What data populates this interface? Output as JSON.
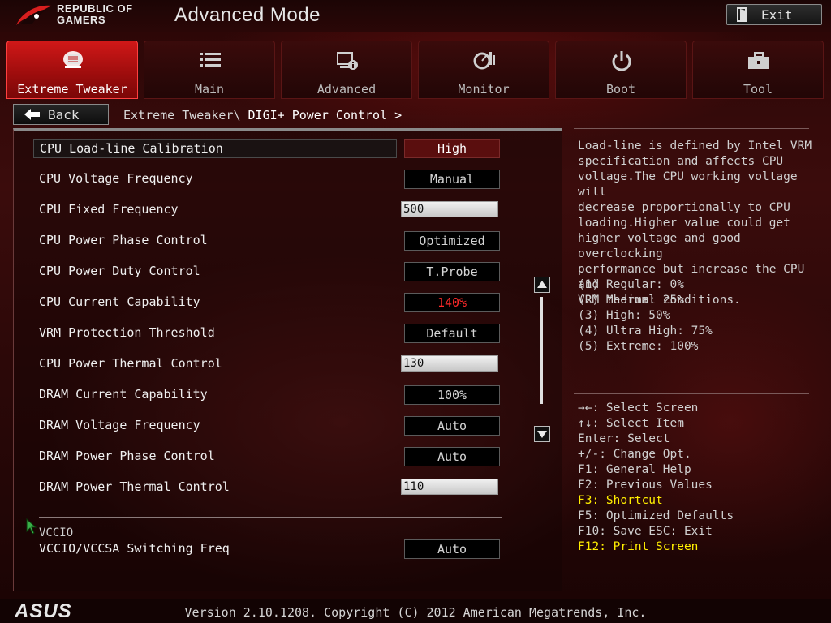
{
  "header": {
    "brand_line1": "REPUBLIC OF",
    "brand_line2": "GAMERS",
    "title": "Advanced Mode",
    "exit_label": "Exit"
  },
  "tabs": [
    {
      "label": "Extreme Tweaker",
      "icon": "extreme-tweaker-icon",
      "active": true
    },
    {
      "label": "Main",
      "icon": "list-icon",
      "active": false
    },
    {
      "label": "Advanced",
      "icon": "advanced-settings-icon",
      "active": false
    },
    {
      "label": "Monitor",
      "icon": "monitor-gauge-icon",
      "active": false
    },
    {
      "label": "Boot",
      "icon": "power-icon",
      "active": false
    },
    {
      "label": "Tool",
      "icon": "toolbox-icon",
      "active": false
    }
  ],
  "nav": {
    "back_label": "Back",
    "breadcrumb_parent": "Extreme Tweaker\\",
    "breadcrumb_current": "DIGI+ Power Control >"
  },
  "settings": [
    {
      "label": "CPU Load-line Calibration",
      "value": "High",
      "kind": "select",
      "selected": true
    },
    {
      "label": "CPU Voltage Frequency",
      "value": "Manual",
      "kind": "select"
    },
    {
      "label": "CPU Fixed Frequency",
      "value": "500",
      "kind": "input"
    },
    {
      "label": "CPU Power Phase Control",
      "value": "Optimized",
      "kind": "select"
    },
    {
      "label": "CPU Power Duty Control",
      "value": "T.Probe",
      "kind": "select"
    },
    {
      "label": "CPU Current Capability",
      "value": "140%",
      "kind": "select",
      "highlight": "#ff2a2a"
    },
    {
      "label": "VRM Protection Threshold",
      "value": "Default",
      "kind": "select"
    },
    {
      "label": "CPU Power Thermal Control",
      "value": "130",
      "kind": "input"
    },
    {
      "label": "DRAM Current Capability",
      "value": "100%",
      "kind": "select"
    },
    {
      "label": "DRAM Voltage Frequency",
      "value": "Auto",
      "kind": "select"
    },
    {
      "label": "DRAM Power Phase Control",
      "value": "Auto",
      "kind": "select"
    },
    {
      "label": "DRAM Power Thermal Control",
      "value": "110",
      "kind": "input"
    }
  ],
  "section": {
    "title": "VCCIO",
    "label": "VCCIO/VCCSA Switching Freq",
    "value": "Auto"
  },
  "help": {
    "description": [
      "Load-line is defined by Intel VRM",
      "specification and affects CPU",
      "voltage.The CPU working voltage will",
      "decrease proportionally to CPU",
      "loading.Higher value could get",
      "higher voltage and good overclocking",
      "performance but increase the CPU and",
      "VRM thermal conditions."
    ],
    "levels": [
      "(1) Regular: 0%",
      "(2) Medium: 25%",
      "(3) High: 50%",
      "(4) Ultra High: 75%",
      "(5) Extreme: 100%"
    ],
    "keys": [
      {
        "text": "→←: Select Screen",
        "highlight": false
      },
      {
        "text": "↑↓: Select Item",
        "highlight": false
      },
      {
        "text": "Enter: Select",
        "highlight": false
      },
      {
        "text": "+/-: Change Opt.",
        "highlight": false
      },
      {
        "text": "F1: General Help",
        "highlight": false
      },
      {
        "text": "F2: Previous Values",
        "highlight": false
      },
      {
        "text": "F3: Shortcut",
        "highlight": true
      },
      {
        "text": "F5: Optimized Defaults",
        "highlight": false
      },
      {
        "text": "F10: Save  ESC: Exit",
        "highlight": false
      },
      {
        "text": "F12: Print Screen",
        "highlight": true
      }
    ]
  },
  "footer": {
    "brand": "ASUS",
    "copyright": "Version 2.10.1208. Copyright (C) 2012 American Megatrends, Inc."
  },
  "colors": {
    "accent_red": "#c81414",
    "shortcut_yellow": "#ffee00",
    "warning_red": "#ff2a2a"
  }
}
